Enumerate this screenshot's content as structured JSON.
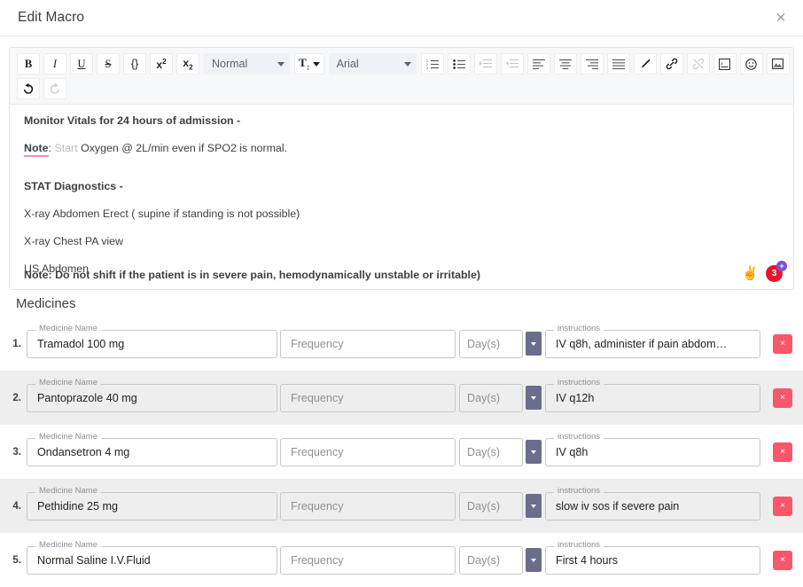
{
  "dialog": {
    "title": "Edit Macro",
    "close_label": "✕"
  },
  "toolbar": {
    "buttons": [
      {
        "name": "bold",
        "label": "B"
      },
      {
        "name": "italic",
        "label": "I"
      },
      {
        "name": "underline",
        "label": "U"
      },
      {
        "name": "strikethrough",
        "label": "S"
      },
      {
        "name": "code-block",
        "label": "{}"
      },
      {
        "name": "superscript",
        "label": "x2"
      },
      {
        "name": "subscript",
        "label": "x2"
      }
    ],
    "block_format": {
      "value": "Normal"
    },
    "font_size_icon": "font-size-icon",
    "font_family": {
      "value": "Arial"
    },
    "list_icons": [
      "ordered-list-icon",
      "bullet-list-icon",
      "indent-increase-icon",
      "indent-decrease-icon",
      "align-left-icon",
      "align-center-icon",
      "align-right-icon",
      "align-justify-icon"
    ],
    "extra_icons": [
      "pen-icon",
      "link-icon",
      "unlink-icon",
      "formula-icon",
      "emoji-icon",
      "image-icon",
      "eraser-icon"
    ],
    "undo_label": "undo-icon",
    "redo_label": "redo-icon"
  },
  "editor": {
    "paragraphs": [
      {
        "bold": true,
        "text": "Monitor Vitals for 24 hours of admission -"
      },
      {
        "note": "Note",
        "faded": "Start",
        "text": "Oxygen @ 2L/min even if SPO2 is normal."
      },
      {
        "spacer": true
      },
      {
        "bold": true,
        "text": "STAT Diagnostics -"
      },
      {
        "bold": false,
        "text": "X-ray Abdomen Erect ( supine if standing is not possible)"
      },
      {
        "bold": false,
        "text": "X-ray Chest PA view"
      },
      {
        "bold": false,
        "text": "US Abdomen"
      }
    ],
    "clipped_line": "Note: Do not shift if the patient is in severe pain, hemodynamically unstable or irritable)",
    "reactions": {
      "hand_emoji": "✌",
      "count": "3",
      "add_label": "+"
    }
  },
  "medicines": {
    "heading": "Medicines",
    "labels": {
      "name_legend": "Medicine Name",
      "frequency_placeholder": "Frequency",
      "days_placeholder": "Day(s)",
      "instructions_legend": "instructions",
      "delete_label": "×"
    },
    "rows": [
      {
        "index": "1.",
        "name": "Tramadol 100 mg",
        "frequency": "",
        "days": "",
        "instructions": "IV q8h, administer if pain abdom…"
      },
      {
        "index": "2.",
        "name": "Pantoprazole 40 mg",
        "frequency": "",
        "days": "",
        "instructions": "IV q12h"
      },
      {
        "index": "3.",
        "name": "Ondansetron 4 mg",
        "frequency": "",
        "days": "",
        "instructions": "IV q8h"
      },
      {
        "index": "4.",
        "name": "Pethidine 25 mg",
        "frequency": "",
        "days": "",
        "instructions": "slow iv sos if severe pain"
      },
      {
        "index": "5.",
        "name": "Normal Saline I.V.Fluid",
        "frequency": "",
        "days": "",
        "instructions": "First 4 hours"
      }
    ]
  },
  "colors": {
    "delete_red": "#f9576a",
    "dropdown_slate": "#6b6d8d",
    "note_underline": "#f48fb1",
    "row_alt_bg": "#eeeeee",
    "reaction_red": "#e8142d",
    "reaction_plus_purple": "#7b4fd8"
  }
}
